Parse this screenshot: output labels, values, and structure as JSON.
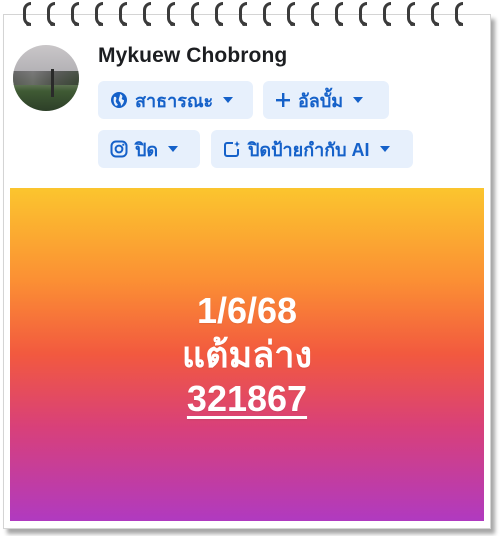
{
  "profile": {
    "name": "Mykuew Chobrong"
  },
  "audience_button": {
    "icon": "globe-icon",
    "label": "สาธารณะ"
  },
  "album_button": {
    "icon": "plus-icon",
    "label": "อัลบั้ม"
  },
  "instagram_button": {
    "icon": "instagram-icon",
    "label": "ปิด"
  },
  "ai_label_button": {
    "icon": "ai-label-icon",
    "label": "ปิดป้ายกำกับ AI"
  },
  "post": {
    "date": "1/6/68",
    "caption": "แต้มล่าง",
    "number": "321867"
  },
  "colors": {
    "chip_background": "#e7f0fc",
    "chip_text": "#1561c9",
    "gradient_top": "#fbc52e",
    "gradient_middle": "#f2593f",
    "gradient_bottom": "#b03ac0"
  }
}
